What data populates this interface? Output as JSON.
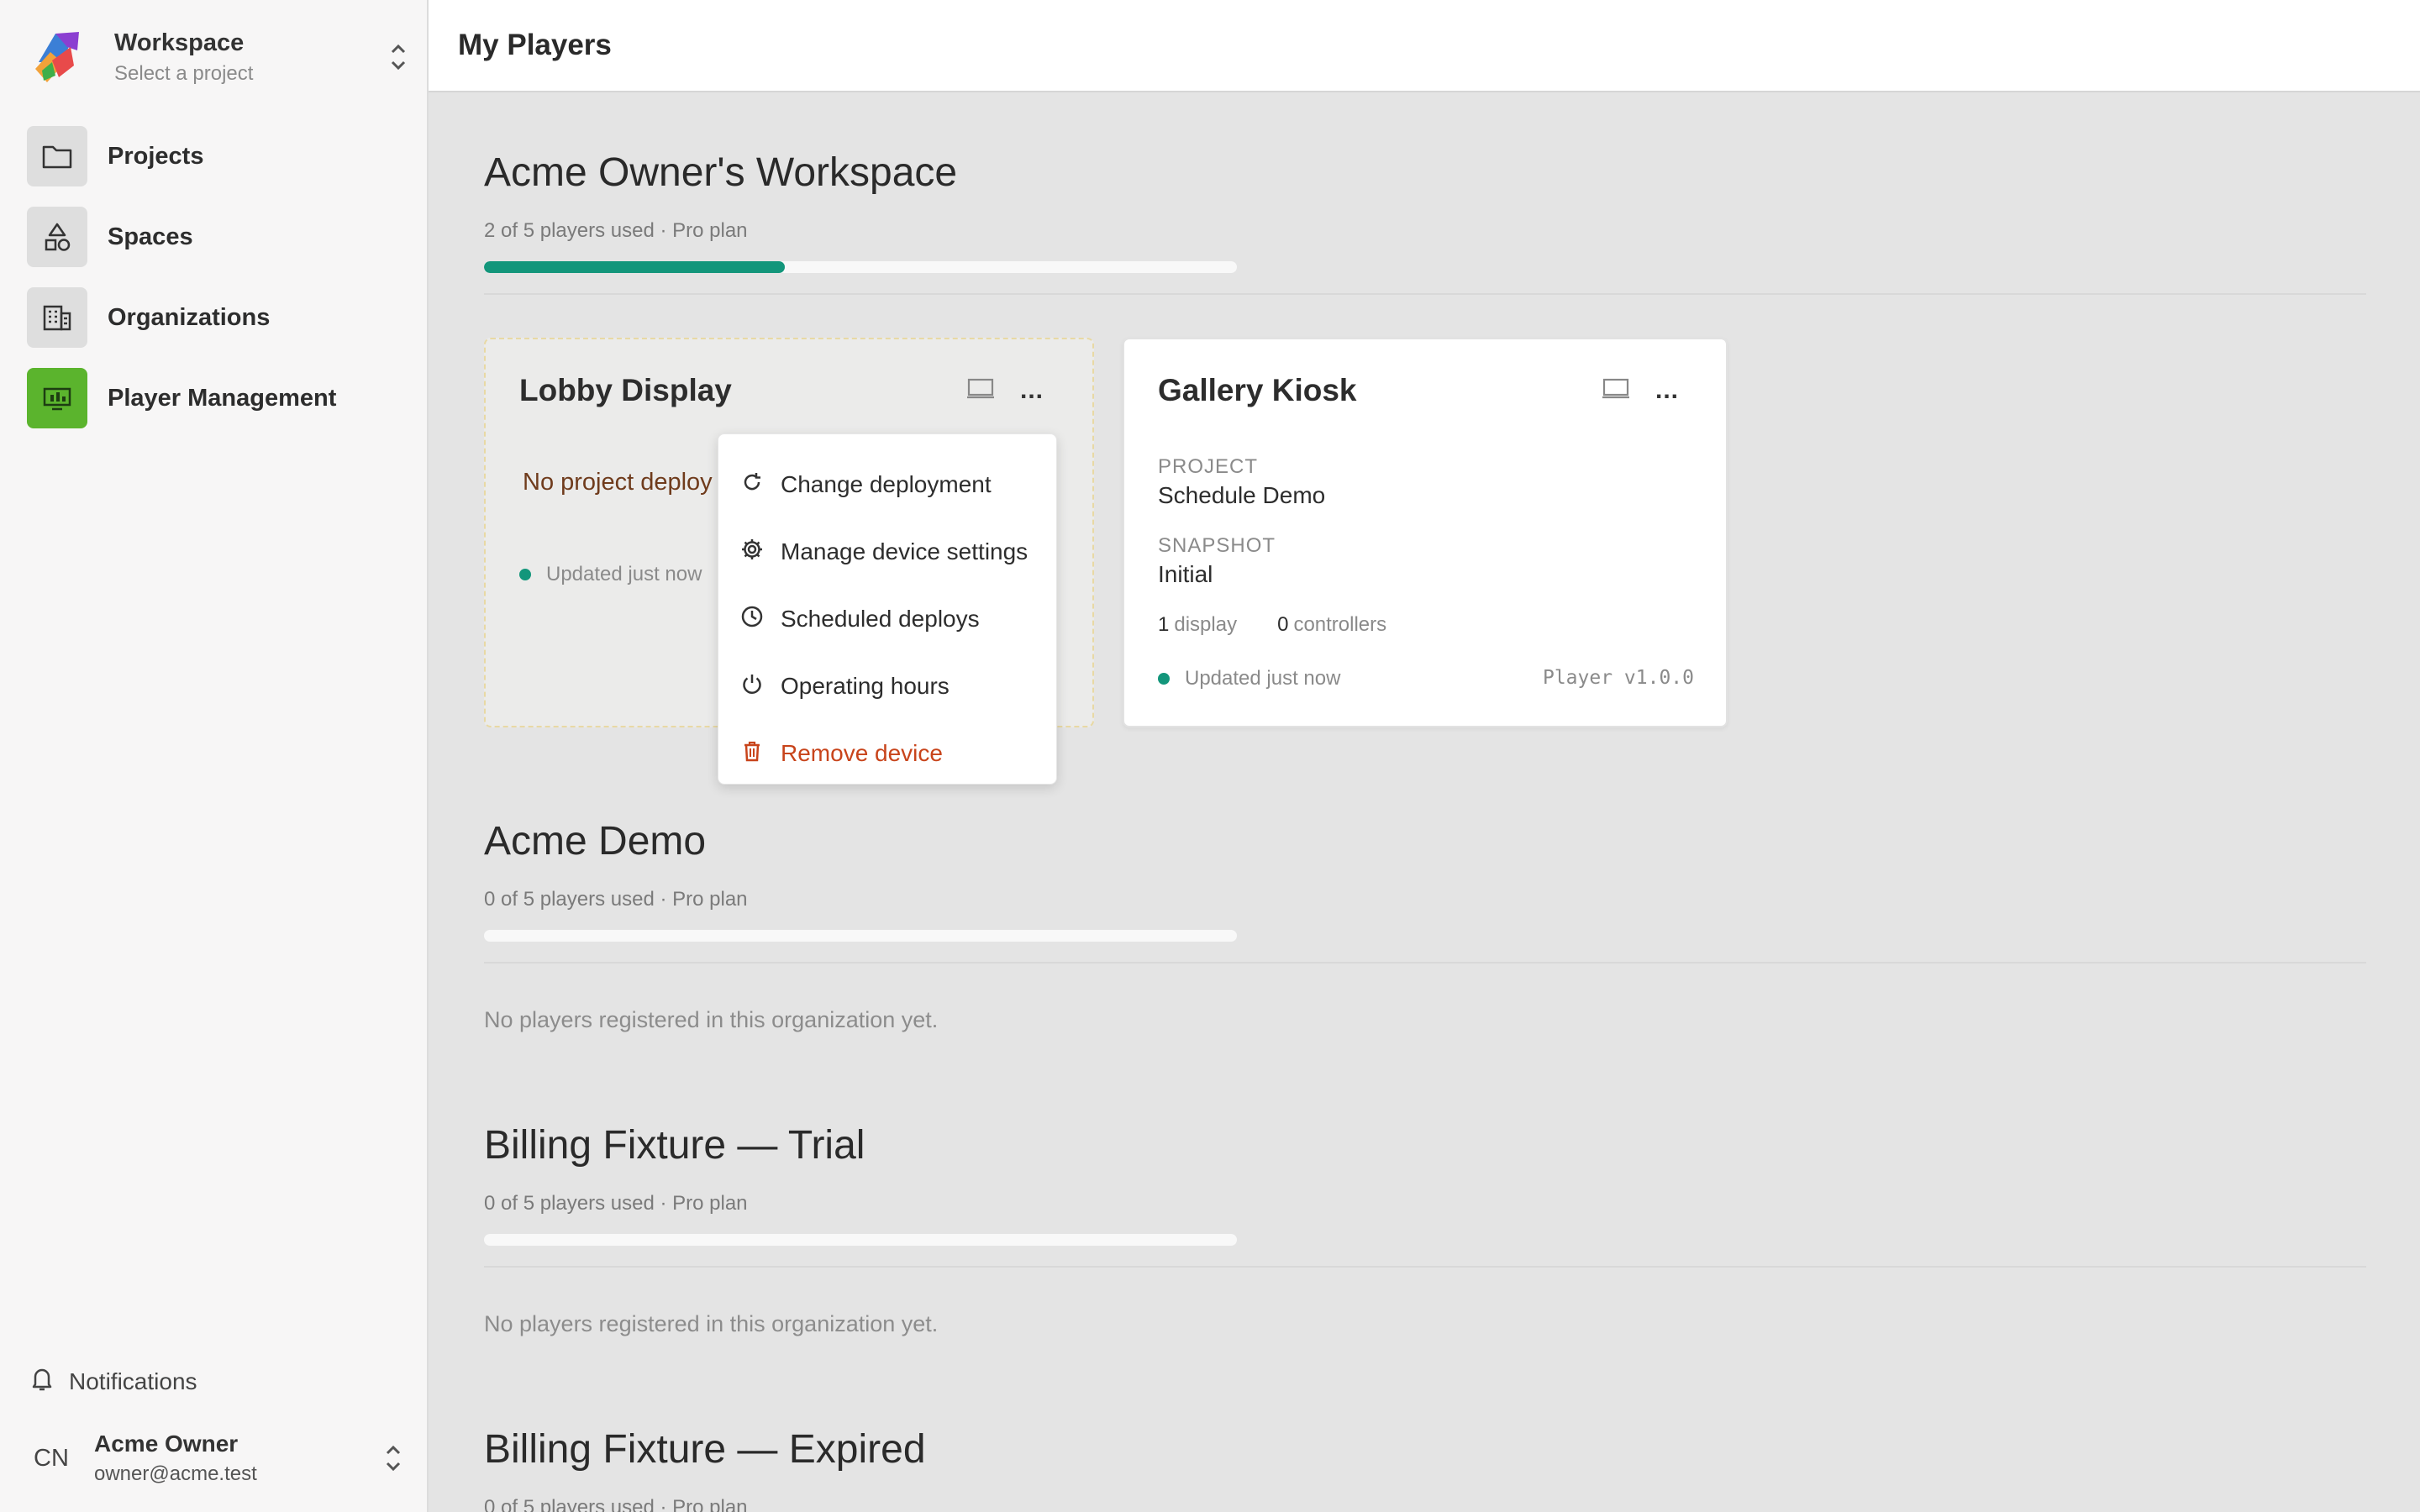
{
  "workspace": {
    "title": "Workspace",
    "subtitle": "Select a project"
  },
  "sidebar": {
    "items": [
      {
        "label": "Projects",
        "icon": "folder-icon",
        "active": false
      },
      {
        "label": "Spaces",
        "icon": "shapes-icon",
        "active": false
      },
      {
        "label": "Organizations",
        "icon": "building-icon",
        "active": false
      },
      {
        "label": "Player Management",
        "icon": "player-icon",
        "active": true
      }
    ],
    "notifications_label": "Notifications",
    "user": {
      "initials": "CN",
      "name": "Acme Owner",
      "email": "owner@acme.test"
    }
  },
  "header": {
    "title": "My Players"
  },
  "colors": {
    "accent": "#5bb42d",
    "progress": "#13967b",
    "danger": "#c8441b"
  },
  "sections": [
    {
      "title": "Acme Owner's Workspace",
      "usage": "2 of 5 players used · Pro plan",
      "used_fraction": 0.4
    },
    {
      "title": "Acme Demo",
      "usage": "0 of 5 players used · Pro plan",
      "used_fraction": 0,
      "empty": "No players registered in this organization yet."
    },
    {
      "title": "Billing Fixture — Trial",
      "usage": "0 of 5 players used · Pro plan",
      "used_fraction": 0,
      "empty": "No players registered in this organization yet."
    },
    {
      "title": "Billing Fixture — Expired",
      "usage": "0 of 5 players used · Pro plan",
      "used_fraction": 0
    }
  ],
  "players": [
    {
      "name": "Lobby Display",
      "no_deploy": "No project deploy",
      "status": "Updated just now",
      "menu": "..."
    },
    {
      "name": "Gallery Kiosk",
      "project_label": "PROJECT",
      "project": "Schedule Demo",
      "snapshot_label": "SNAPSHOT",
      "snapshot": "Initial",
      "displays_count": "1",
      "displays_label": "display",
      "controllers_count": "0",
      "controllers_label": "controllers",
      "status": "Updated just now",
      "version": "Player v1.0.0",
      "menu": "..."
    }
  ],
  "device_menu": {
    "items": [
      {
        "label": "Change deployment",
        "icon": "refresh-icon"
      },
      {
        "label": "Manage device settings",
        "icon": "gear-icon"
      },
      {
        "label": "Scheduled deploys",
        "icon": "clock-icon"
      },
      {
        "label": "Operating hours",
        "icon": "power-icon"
      },
      {
        "label": "Remove device",
        "icon": "trash-icon"
      }
    ]
  }
}
